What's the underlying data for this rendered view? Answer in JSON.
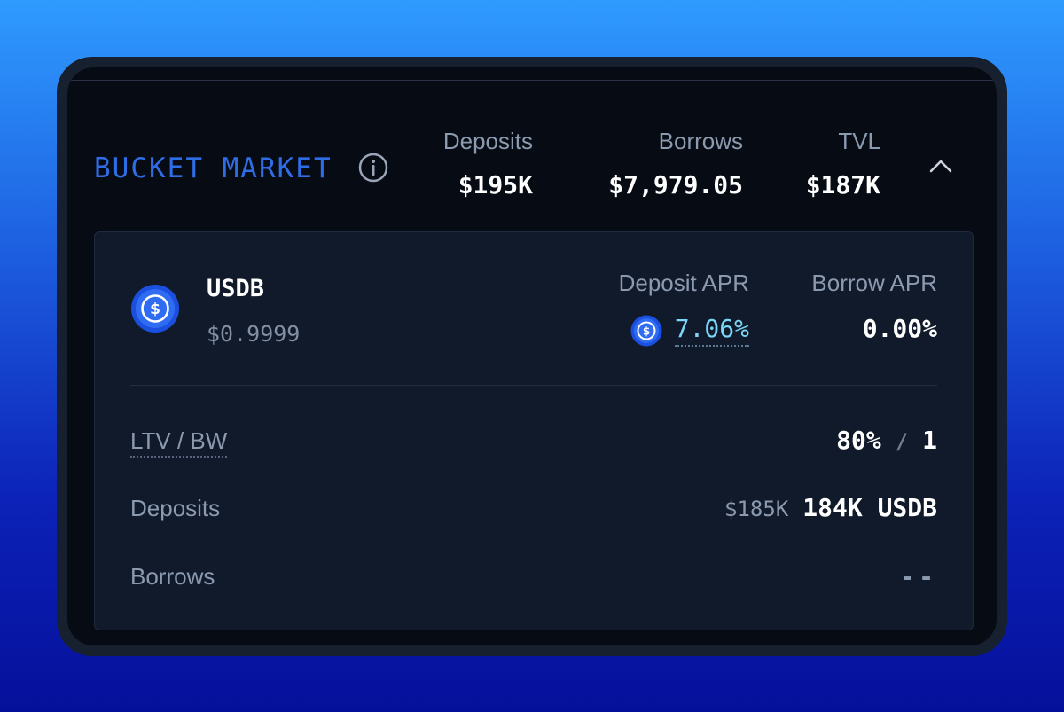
{
  "market": {
    "title": "BUCKET MARKET",
    "info_icon": "info-circle-icon",
    "collapse_icon": "chevron-up-icon",
    "stats": [
      {
        "label": "Deposits",
        "value": "$195K"
      },
      {
        "label": "Borrows",
        "value": "$7,979.05"
      },
      {
        "label": "TVL",
        "value": "$187K"
      }
    ]
  },
  "asset": {
    "icon": "usdb-dollar-coin-icon",
    "name": "USDB",
    "price": "$0.9999",
    "deposit_apr_label": "Deposit APR",
    "deposit_apr_value": "7.06%",
    "deposit_apr_icon": "usdb-dollar-coin-icon",
    "borrow_apr_label": "Borrow APR",
    "borrow_apr_value": "0.00%"
  },
  "details": {
    "ltv_label": "LTV / BW",
    "ltv_value": "80%",
    "ltv_separator": "/",
    "bw_value": "1",
    "deposits_label": "Deposits",
    "deposits_usd": "$185K",
    "deposits_amount": "184K USDB",
    "borrows_label": "Borrows",
    "borrows_value": "--"
  },
  "colors": {
    "accent_blue": "#2f6de6",
    "apr_cyan": "#7ad7f7",
    "panel_bg": "#060b14",
    "card_bg": "#111a2a"
  }
}
